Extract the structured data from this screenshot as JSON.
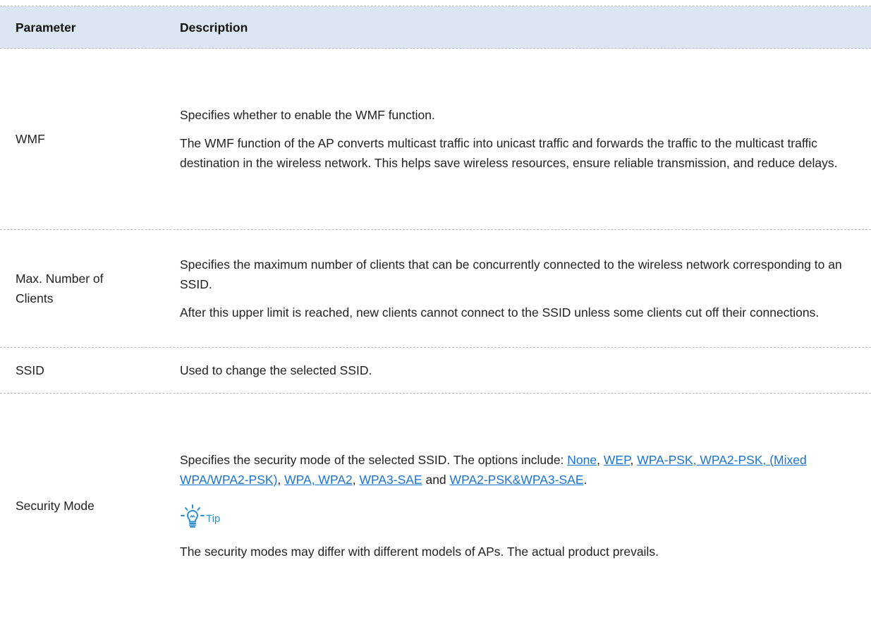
{
  "header": {
    "param": "Parameter",
    "desc": "Description"
  },
  "rows": {
    "wmf": {
      "param": "WMF",
      "p1": "Specifies whether to enable the WMF function.",
      "p2": "The WMF function of the AP converts multicast traffic into unicast traffic and forwards the traffic to the multicast traffic destination in the wireless network. This helps save wireless resources, ensure reliable transmission, and reduce delays."
    },
    "max_clients": {
      "param": "Max. Number of Clients",
      "p1": "Specifies the maximum number of clients that can be concurrently connected to the wireless network corresponding to an SSID.",
      "p2": "After this upper limit is reached, new clients cannot connect to the SSID unless some clients cut off their connections."
    },
    "ssid": {
      "param": "SSID",
      "p1": "Used to change the selected SSID."
    },
    "security": {
      "param": "Security Mode",
      "intro": "Specifies the security mode of the selected SSID. The options include: ",
      "links": {
        "none": "None",
        "wep": "WEP",
        "wpa_psk_group": "WPA-PSK, WPA2-PSK, (Mixed WPA/WPA2-PSK)",
        "wpa_group": "WPA, WPA2",
        "wpa3_sae": "WPA3-SAE",
        "mixed_sae": "WPA2-PSK&WPA3-SAE"
      },
      "sep_comma": ", ",
      "sep_and": " and ",
      "end": ".",
      "tip_label": "Tip",
      "tip_text": "The security modes may differ with different models of APs. The actual product prevails."
    }
  },
  "colors": {
    "header_bg": "#dbe6f2",
    "link": "#1a73d1",
    "tip": "#2b8fd6"
  },
  "icons": {
    "tip": "lightbulb-icon"
  }
}
